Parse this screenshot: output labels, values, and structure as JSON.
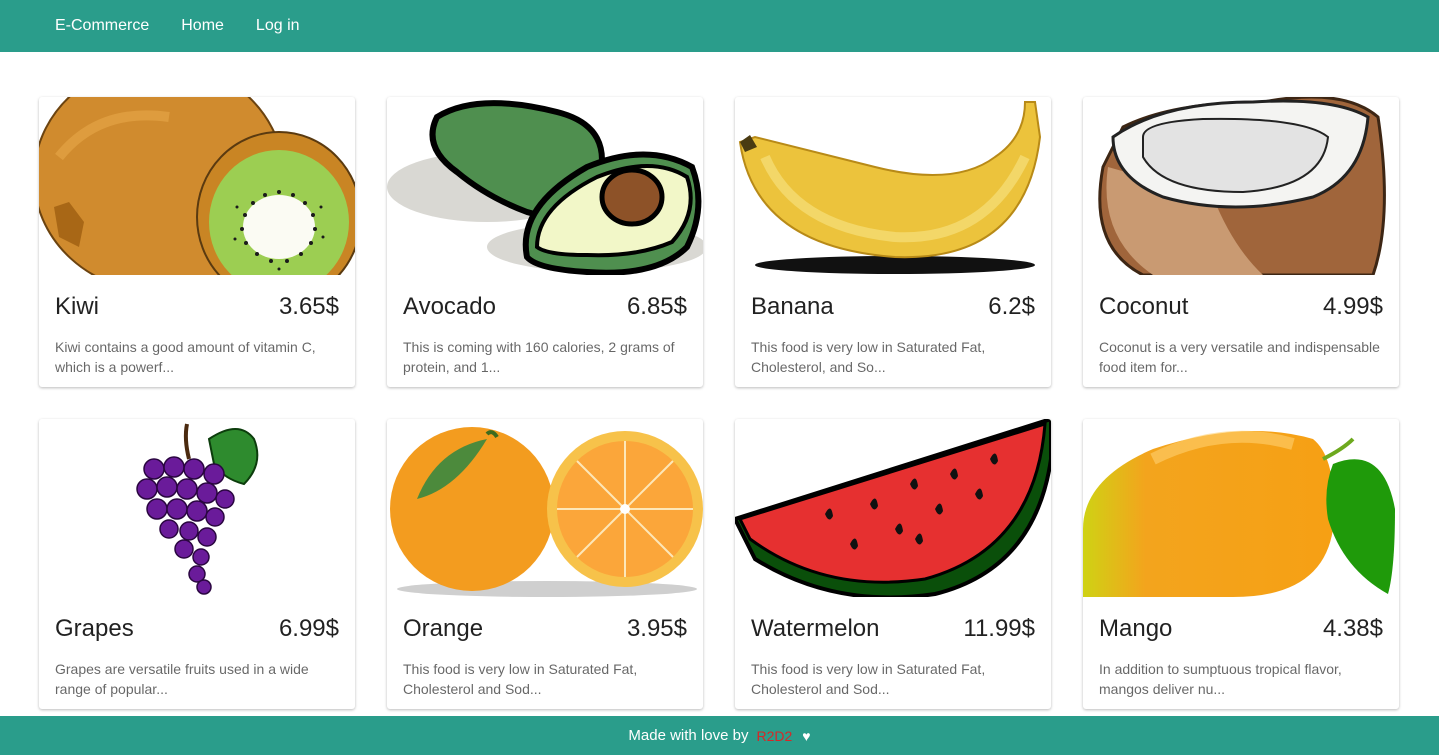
{
  "nav": {
    "brand": "E-Commerce",
    "home": "Home",
    "login": "Log in"
  },
  "products": [
    {
      "name": "Kiwi",
      "price": "3.65$",
      "desc": "Kiwi contains a good amount of vitamin C, which is a powerf...",
      "icon": "kiwi-image"
    },
    {
      "name": "Avocado",
      "price": "6.85$",
      "desc": "This is coming with 160 calories, 2 grams of protein, and 1...",
      "icon": "avocado-image"
    },
    {
      "name": "Banana",
      "price": "6.2$",
      "desc": "This food is very low in Saturated Fat, Cholesterol, and So...",
      "icon": "banana-image"
    },
    {
      "name": "Coconut",
      "price": "4.99$",
      "desc": "Coconut is a very versatile and indispensable food item for...",
      "icon": "coconut-image"
    },
    {
      "name": "Grapes",
      "price": "6.99$",
      "desc": "Grapes are versatile fruits used in a wide range of popular...",
      "icon": "grapes-image"
    },
    {
      "name": "Orange",
      "price": "3.95$",
      "desc": "This food is very low in Saturated Fat, Cholesterol and Sod...",
      "icon": "orange-image"
    },
    {
      "name": "Watermelon",
      "price": "11.99$",
      "desc": "This food is very low in Saturated Fat, Cholesterol and Sod...",
      "icon": "watermelon-image"
    },
    {
      "name": "Mango",
      "price": "4.38$",
      "desc": "In addition to sumptuous tropical flavor, mangos deliver nu...",
      "icon": "mango-image"
    }
  ],
  "footer": {
    "text": "Made with love by",
    "author": "R2D2",
    "heart": "♥"
  },
  "colors": {
    "primary": "#2a9d8b",
    "author": "#d62828"
  }
}
